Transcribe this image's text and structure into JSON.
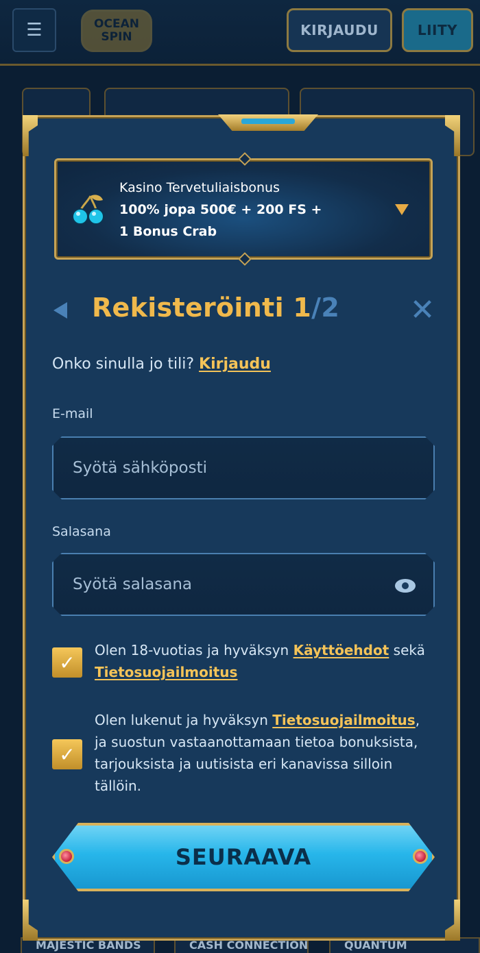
{
  "header": {
    "logo_line1": "OCEAN",
    "logo_line2": "SPIN",
    "login_label": "KIRJAUDU",
    "join_label": "LIITY"
  },
  "background": {
    "bottom_games": [
      "MAJESTIC BANDS",
      "CASH CONNECTION",
      "QUANTUM"
    ]
  },
  "bonus": {
    "title": "Kasino Tervetuliaisbonus",
    "line1": "100% jopa 500€ + 200 FS +",
    "line2": "1 Bonus Crab"
  },
  "registration": {
    "title": "Rekisteröinti 1",
    "step_total": "/2",
    "have_account_text": "Onko sinulla jo tili?",
    "login_link": "Kirjaudu",
    "email_label": "E-mail",
    "email_placeholder": "Syötä sähköposti",
    "password_label": "Salasana",
    "password_placeholder": "Syötä salasana",
    "terms": {
      "before": "Olen 18-vuotias ja hyväksyn",
      "link1": "Käyttöehdot",
      "middle": "sekä",
      "link2": "Tietosuojailmoitus",
      "checked": true
    },
    "marketing": {
      "before": "Olen lukenut ja hyväksyn",
      "link": "Tietosuojailmoitus",
      "after": ", ja suostun vastaanottamaan tietoa bonuksista, tarjouksista ja uutisista eri kanavissa silloin tällöin.",
      "checked": true
    },
    "next_label": "SEURAAVA"
  }
}
